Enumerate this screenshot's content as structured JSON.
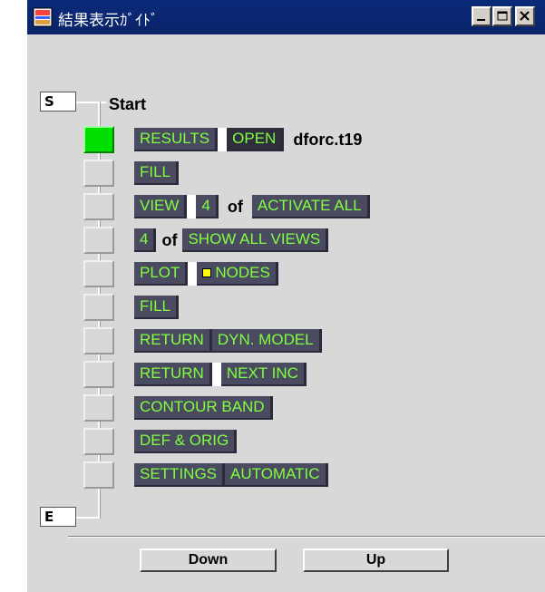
{
  "window": {
    "title": "結果表示ｶﾞｲﾄﾞ"
  },
  "titlebar_buttons": [
    "minimize",
    "maximize",
    "close"
  ],
  "tree": {
    "start_label": "S",
    "start_text": "Start",
    "end_label": "E"
  },
  "steps": [
    {
      "active": true,
      "items": [
        {
          "t": "chip",
          "v": "RESULTS"
        },
        {
          "t": "white"
        },
        {
          "t": "chip",
          "v": "OPEN",
          "dark": true
        },
        {
          "t": "text",
          "v": "dforc.t19"
        }
      ]
    },
    {
      "active": false,
      "items": [
        {
          "t": "chip",
          "v": "FILL"
        }
      ]
    },
    {
      "active": false,
      "items": [
        {
          "t": "chip",
          "v": "VIEW"
        },
        {
          "t": "white"
        },
        {
          "t": "chip",
          "v": "4"
        },
        {
          "t": "text",
          "v": "of"
        },
        {
          "t": "chip",
          "v": "ACTIVATE ALL"
        }
      ]
    },
    {
      "active": false,
      "items": [
        {
          "t": "chip",
          "v": "4"
        },
        {
          "t": "text",
          "v": "of",
          "small": true
        },
        {
          "t": "chip",
          "v": "SHOW ALL VIEWS"
        }
      ]
    },
    {
      "active": false,
      "items": [
        {
          "t": "chip",
          "v": "PLOT"
        },
        {
          "t": "white"
        },
        {
          "t": "chip",
          "v": "NODES",
          "icon": true
        }
      ]
    },
    {
      "active": false,
      "items": [
        {
          "t": "chip",
          "v": "FILL"
        }
      ]
    },
    {
      "active": false,
      "items": [
        {
          "t": "chip",
          "v": "RETURN"
        },
        {
          "t": "chip",
          "v": "DYN. MODEL"
        }
      ]
    },
    {
      "active": false,
      "items": [
        {
          "t": "chip",
          "v": "RETURN"
        },
        {
          "t": "white"
        },
        {
          "t": "chip",
          "v": "NEXT INC"
        }
      ]
    },
    {
      "active": false,
      "items": [
        {
          "t": "chip",
          "v": "CONTOUR BAND"
        }
      ]
    },
    {
      "active": false,
      "items": [
        {
          "t": "chip",
          "v": "DEF & ORIG"
        }
      ]
    },
    {
      "active": false,
      "items": [
        {
          "t": "chip",
          "v": "SETTINGS"
        },
        {
          "t": "chip",
          "v": "AUTOMATIC"
        }
      ]
    }
  ],
  "buttons": {
    "down": "Down",
    "up": "Up"
  },
  "colors": {
    "chip_bg": "#4a4a60",
    "chip_text": "#80ff40",
    "active_step": "#00e000",
    "titlebar": "#0a246a"
  }
}
